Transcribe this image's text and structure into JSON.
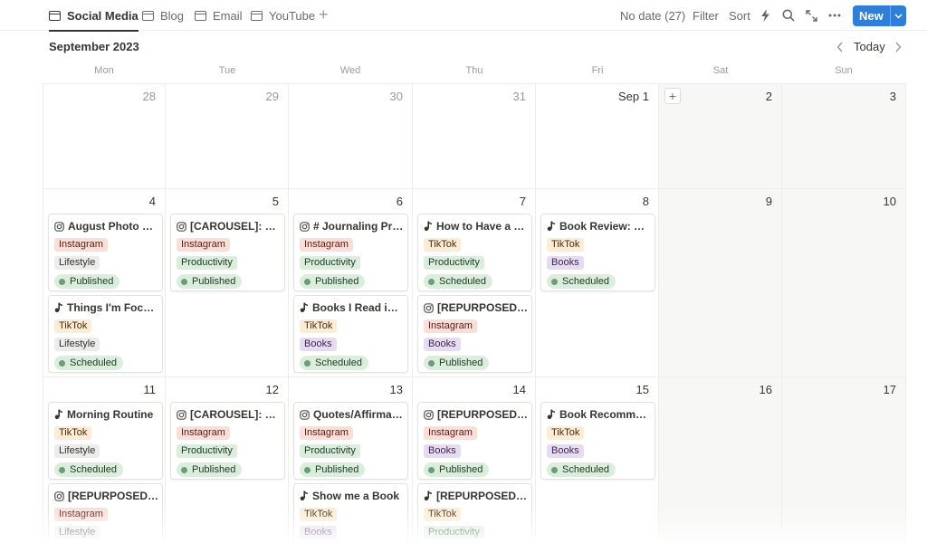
{
  "tabs": [
    {
      "label": "Social Media",
      "active": true
    },
    {
      "label": "Blog",
      "active": false
    },
    {
      "label": "Email",
      "active": false
    },
    {
      "label": "YouTube",
      "active": false
    }
  ],
  "toolbar": {
    "no_date": "No date (27)",
    "filter": "Filter",
    "sort": "Sort",
    "new_label": "New"
  },
  "calendar": {
    "month": "September 2023",
    "today": "Today",
    "weekdays": [
      "Mon",
      "Tue",
      "Wed",
      "Thu",
      "Fri",
      "Sat",
      "Sun"
    ],
    "weeks": [
      [
        {
          "label": "28",
          "muted": true
        },
        {
          "label": "29",
          "muted": true
        },
        {
          "label": "30",
          "muted": true
        },
        {
          "label": "31",
          "muted": true
        },
        {
          "label": "Sep 1"
        },
        {
          "label": "2",
          "weekend": true,
          "add": true
        },
        {
          "label": "3",
          "weekend": true
        }
      ],
      [
        {
          "label": "4",
          "cards": [
            {
              "icon": "instagram",
              "title": "August Photo Dump",
              "platform": "Instagram",
              "topic": "Lifestyle",
              "status": "Published"
            },
            {
              "icon": "tiktok",
              "title": "Things I'm Focusing On",
              "platform": "TikTok",
              "topic": "Lifestyle",
              "status": "Scheduled"
            }
          ]
        },
        {
          "label": "5",
          "cards": [
            {
              "icon": "instagram",
              "title": "[CAROUSEL]: How to Plan",
              "platform": "Instagram",
              "topic": "Productivity",
              "status": "Published"
            }
          ]
        },
        {
          "label": "6",
          "cards": [
            {
              "icon": "instagram",
              "title": "# Journaling Prompts",
              "platform": "Instagram",
              "topic": "Productivity",
              "status": "Published"
            },
            {
              "icon": "tiktok",
              "title": "Books I Read in August",
              "platform": "TikTok",
              "topic": "Books",
              "status": "Scheduled"
            }
          ]
        },
        {
          "label": "7",
          "cards": [
            {
              "icon": "tiktok",
              "title": "How to Have a Productive Day",
              "platform": "TikTok",
              "topic": "Productivity",
              "status": "Scheduled"
            },
            {
              "icon": "instagram",
              "title": "[REPURPOSED]: Book List",
              "platform": "Instagram",
              "topic": "Books",
              "status": "Published"
            }
          ]
        },
        {
          "label": "8",
          "cards": [
            {
              "icon": "tiktok",
              "title": "Book Review: One of Us",
              "platform": "TikTok",
              "topic": "Books",
              "status": "Scheduled"
            }
          ]
        },
        {
          "label": "9",
          "weekend": true
        },
        {
          "label": "10",
          "weekend": true
        }
      ],
      [
        {
          "label": "11",
          "cards": [
            {
              "icon": "tiktok",
              "title": "Morning Routine",
              "platform": "TikTok",
              "topic": "Lifestyle",
              "status": "Scheduled"
            },
            {
              "icon": "instagram",
              "title": "[REPURPOSED]: Routine",
              "platform": "Instagram",
              "topic": "Lifestyle",
              "status": ""
            }
          ]
        },
        {
          "label": "12",
          "cards": [
            {
              "icon": "instagram",
              "title": "[CAROUSEL]: Tips",
              "platform": "Instagram",
              "topic": "Productivity",
              "status": "Published"
            }
          ]
        },
        {
          "label": "13",
          "cards": [
            {
              "icon": "instagram",
              "title": "Quotes/Affirmations",
              "platform": "Instagram",
              "topic": "Productivity",
              "status": "Published"
            },
            {
              "icon": "tiktok",
              "title": "Show me a Book",
              "platform": "TikTok",
              "topic": "Books",
              "status": ""
            }
          ]
        },
        {
          "label": "14",
          "cards": [
            {
              "icon": "instagram",
              "title": "[REPURPOSED]: Reviews",
              "platform": "Instagram",
              "topic": "Books",
              "status": "Published"
            },
            {
              "icon": "tiktok",
              "title": "[REPURPOSED]: Planning",
              "platform": "TikTok",
              "topic": "Productivity",
              "status": ""
            }
          ]
        },
        {
          "label": "15",
          "cards": [
            {
              "icon": "tiktok",
              "title": "Book Recommendations",
              "platform": "TikTok",
              "topic": "Books",
              "status": "Scheduled"
            }
          ]
        },
        {
          "label": "16",
          "weekend": true
        },
        {
          "label": "17",
          "weekend": true
        }
      ]
    ]
  },
  "tag_colors": {
    "Instagram": {
      "bg": "#fadfd9",
      "fg": "#5d1715"
    },
    "TikTok": {
      "bg": "#fbecd5",
      "fg": "#49290e"
    },
    "Lifestyle": {
      "bg": "#ececea",
      "fg": "#32302c"
    },
    "Productivity": {
      "bg": "#dbeddb",
      "fg": "#1c3829"
    },
    "Books": {
      "bg": "#e6dcf1",
      "fg": "#412454"
    }
  },
  "status_colors": {
    "Published": {
      "bg": "#dbeddb",
      "fg": "#1c3829",
      "dot": "#6c9b7d"
    },
    "Scheduled": {
      "bg": "#dbeddb",
      "fg": "#1c3829",
      "dot": "#6c9b7d"
    }
  }
}
